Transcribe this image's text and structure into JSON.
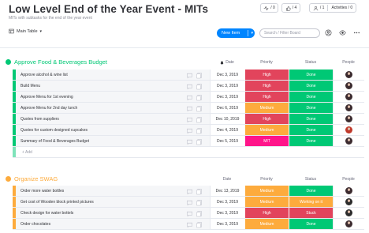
{
  "header": {
    "title": "Low Level End of the Year Event - MITs",
    "subtitle": "MITs with subtasks for the end of the year event",
    "activity_count": "/ 0",
    "likes_count": "/ 4",
    "members_count": "/ 1",
    "activities_label": "Activities / 0"
  },
  "toolbar": {
    "view_label": "Main Table",
    "new_item_label": "New Item",
    "search_placeholder": "Search / Filter Board"
  },
  "columns": {
    "date": "Date",
    "priority": "Priority",
    "status": "Status",
    "people": "People"
  },
  "groups": [
    {
      "title": "Approve Food & Beverages Budget",
      "color": "#00c875",
      "items": [
        {
          "name": "Approve alcohol & wine list",
          "date": "Dec 3, 2019",
          "priority": "High",
          "priority_color": "#e2445c",
          "status": "Done",
          "status_color": "#00c875",
          "avatar_color": "#3b2b2f"
        },
        {
          "name": "Build Menu",
          "date": "Dec 3, 2019",
          "priority": "High",
          "priority_color": "#e2445c",
          "status": "Done",
          "status_color": "#00c875",
          "avatar_color": "#3b2b2f"
        },
        {
          "name": "Approve Menu for 1st evening",
          "date": "Dec 3, 2019",
          "priority": "High",
          "priority_color": "#e2445c",
          "status": "Done",
          "status_color": "#00c875",
          "avatar_color": "#3b2b2f"
        },
        {
          "name": "Approve Menu for 2nd day lunch",
          "date": "Dec 6, 2019",
          "priority": "Medium",
          "priority_color": "#fdab3d",
          "status": "Done",
          "status_color": "#00c875",
          "avatar_color": "#3b2b2f"
        },
        {
          "name": "Quotes from suppliers",
          "date": "Dec 10, 2019",
          "priority": "High",
          "priority_color": "#e2445c",
          "status": "Done",
          "status_color": "#00c875",
          "avatar_color": "#3b2b2f"
        },
        {
          "name": "Quotes for custom designed cupcakes",
          "date": "Dec 4, 2019",
          "priority": "Medium",
          "priority_color": "#fdab3d",
          "status": "Done",
          "status_color": "#00c875",
          "avatar_color": "#c0392b"
        },
        {
          "name": "Summary of Food & Beverages Budget",
          "date": "Dec 5, 2019",
          "priority": "MIT",
          "priority_color": "#ff158a",
          "status": "Done",
          "status_color": "#00c875",
          "avatar_color": "#3b2b2f"
        }
      ],
      "add_label": "+ Add"
    },
    {
      "title": "Organize SWAG",
      "color": "#fdab3d",
      "items": [
        {
          "name": "Order more water bottles",
          "date": "Dec 13, 2019",
          "priority": "Medium",
          "priority_color": "#fdab3d",
          "status": "Done",
          "status_color": "#00c875",
          "avatar_color": "#3b2b2f"
        },
        {
          "name": "Get cost of Wooden block printed pictures",
          "date": "Dec 3, 2019",
          "priority": "Medium",
          "priority_color": "#fdab3d",
          "status": "Working on it",
          "status_color": "#fdab3d",
          "avatar_color": "#2b2b2b"
        },
        {
          "name": "Check design for water bottels",
          "date": "Dec 3, 2019",
          "priority": "High",
          "priority_color": "#e2445c",
          "status": "Stuck",
          "status_color": "#e2445c",
          "avatar_color": "#2b2b2b"
        },
        {
          "name": "Order chocolates",
          "date": "Dec 3, 2019",
          "priority": "Medium",
          "priority_color": "#fdab3d",
          "status": "Done",
          "status_color": "#00c875",
          "avatar_color": "#3b2b2f"
        }
      ]
    }
  ]
}
